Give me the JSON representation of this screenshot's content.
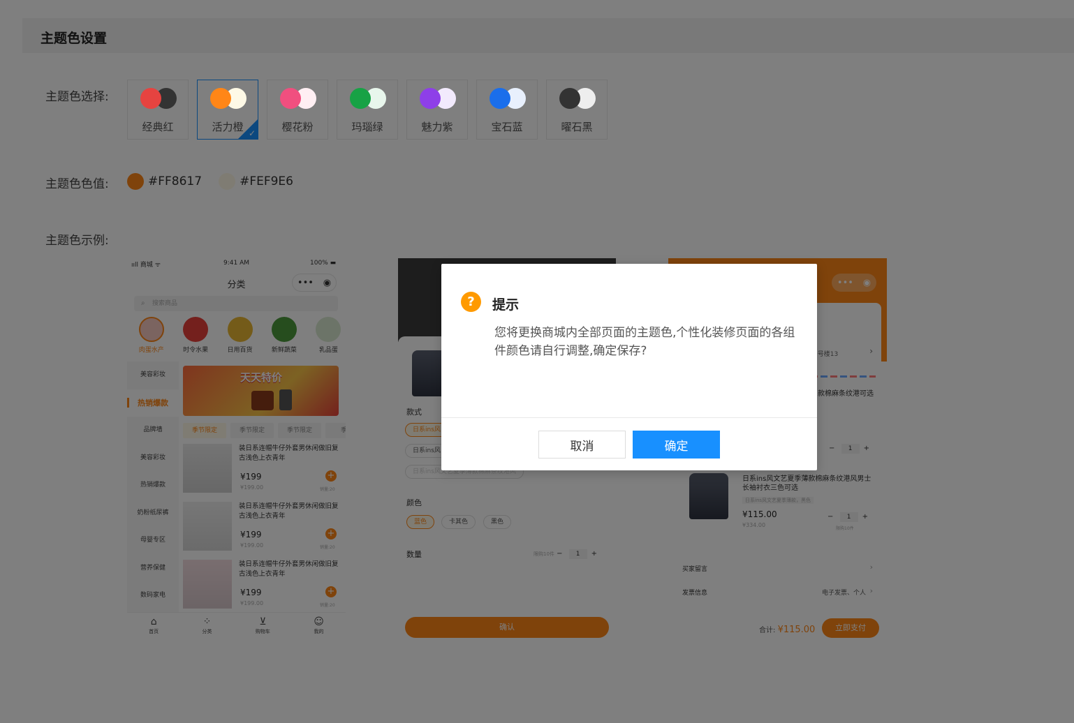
{
  "page": {
    "title": "主题色设置"
  },
  "theme_select": {
    "label": "主题色选择:",
    "options": [
      {
        "name": "经典红",
        "primary": "#E64340",
        "secondary": "#333333"
      },
      {
        "name": "活力橙",
        "primary": "#FF8617",
        "secondary": "#FEF9E6",
        "selected": true
      },
      {
        "name": "樱花粉",
        "primary": "#F04F7F",
        "secondary": "#FFEFF3"
      },
      {
        "name": "玛瑙绿",
        "primary": "#17A245",
        "secondary": "#E8F6EC"
      },
      {
        "name": "魅力紫",
        "primary": "#8E3FE8",
        "secondary": "#F2EAFD"
      },
      {
        "name": "宝石蓝",
        "primary": "#1A6EEB",
        "secondary": "#E8F0FD"
      },
      {
        "name": "曜石黑",
        "primary": "#333333",
        "secondary": "#EEEEEE"
      }
    ]
  },
  "theme_value": {
    "label": "主题色色值:",
    "primary_hex": "#FF8617",
    "secondary_hex": "#FEF9E6"
  },
  "theme_example": {
    "label": "主题色示例:"
  },
  "preview1": {
    "status_left": "ııll 商城 ᯤ",
    "status_time": "9:41 AM",
    "status_batt": "100% ▬",
    "title": "分类",
    "search_placeholder": "搜索商品",
    "categories": [
      "肉蛋水产",
      "时令水果",
      "日用百货",
      "新鲜蔬菜",
      "乳品蛋"
    ],
    "sidebar": [
      "美容彩妆",
      "热销爆款",
      "品牌墙",
      "美容彩妆",
      "热销爆款",
      "奶粉纸尿裤",
      "母婴专区",
      "营养保健",
      "数码家电"
    ],
    "banner_text": "天天特价",
    "chips": [
      "季节限定",
      "季节限定",
      "季节限定",
      "季节"
    ],
    "products": [
      {
        "name": "装日系连帽牛仔外套男休闲做旧复古浅色上衣青年",
        "price": "¥199",
        "orig": "¥199.00",
        "sold": "销量:20"
      },
      {
        "name": "装日系连帽牛仔外套男休闲做旧复古浅色上衣青年",
        "price": "¥199",
        "orig": "¥199.00",
        "sold": "销量:20"
      },
      {
        "name": "装日系连帽牛仔外套男休闲做旧复古浅色上衣青年",
        "price": "¥199",
        "orig": "¥199.00",
        "sold": "销量:20"
      }
    ],
    "tabs": [
      "首页",
      "分类",
      "购物车",
      "我的"
    ]
  },
  "preview2": {
    "style_label": "款式",
    "style_opts": [
      "日系ins风",
      "日系ins风",
      "日系ins风文艺夏季薄款棉麻条纹港风"
    ],
    "color_label": "颜色",
    "color_opts": [
      "蓝色",
      "卡其色",
      "黑色"
    ],
    "qty_label": "数量",
    "qty_limit": "限购10件",
    "qty_value": "1",
    "confirm": "确认"
  },
  "preview3": {
    "addr_tail": "2号楼13",
    "item1_name": "款棉麻条纹港可选",
    "item2_name": "日系ins风文艺夏季薄款棉麻条纹港风男士长袖衬衣三色可选",
    "item2_tag": "日系ins风文艺夏季薄款，黑色",
    "item2_price": "¥115.00",
    "item2_orig": "¥334.00",
    "item2_limit": "限购10件",
    "qty_value": "1",
    "remark_label": "买家留言",
    "invoice_label": "发票信息",
    "invoice_value": "电子发票、个人",
    "total_label": "合计:",
    "total_value": "¥115.00",
    "pay_label": "立即支付"
  },
  "dialog": {
    "title": "提示",
    "icon_glyph": "?",
    "message": "您将更换商城内全部页面的主题色,个性化装修页面的各组件颜色请自行调整,确定保存?",
    "cancel": "取消",
    "ok": "确定"
  }
}
